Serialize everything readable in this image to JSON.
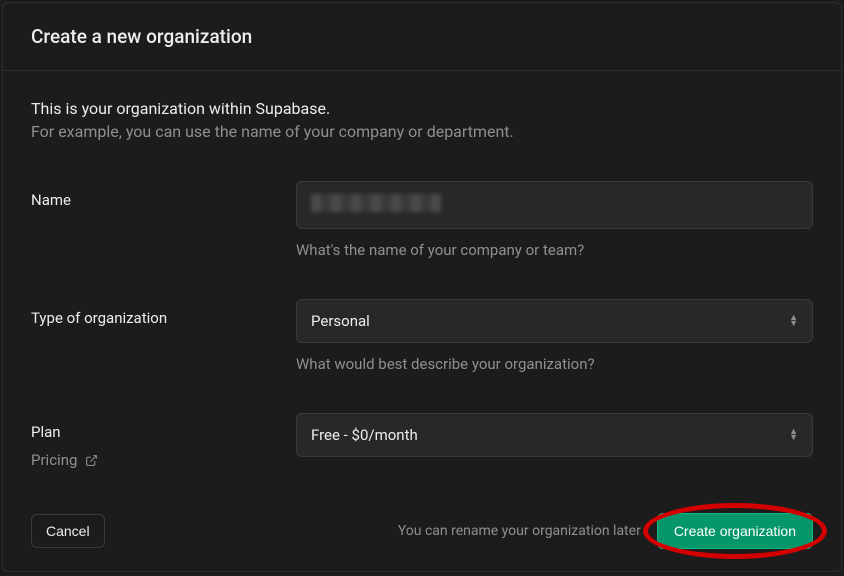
{
  "header": {
    "title": "Create a new organization"
  },
  "intro": {
    "title": "This is your organization within Supabase.",
    "subtitle": "For example, you can use the name of your company or department."
  },
  "fields": {
    "name": {
      "label": "Name",
      "helper": "What's the name of your company or team?"
    },
    "type": {
      "label": "Type of organization",
      "value": "Personal",
      "helper": "What would best describe your organization?"
    },
    "plan": {
      "label": "Plan",
      "pricing_link": "Pricing",
      "value": "Free - $0/month"
    }
  },
  "footer": {
    "cancel": "Cancel",
    "hint": "You can rename your organization later",
    "create": "Create organization"
  }
}
